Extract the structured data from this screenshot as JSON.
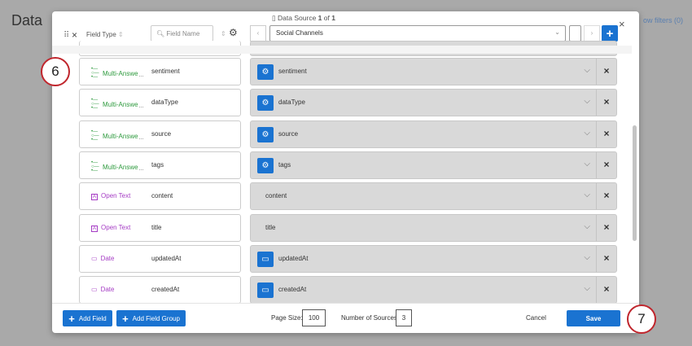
{
  "background": {
    "title": "Data",
    "filters": "ow filters (0)"
  },
  "header": {
    "field_type": "Field Type",
    "field_name_placeholder": "Field Name",
    "data_source_prefix": "Data Source",
    "data_source_current": "1",
    "data_source_of": "of",
    "data_source_total": "1",
    "source_select": "Social Channels"
  },
  "rows": [
    {
      "type": "Multi-Answe",
      "suffix": "...",
      "name": "sentiment",
      "kind": "multi",
      "mapped": "sentiment",
      "icon": "gear"
    },
    {
      "type": "Multi-Answe",
      "suffix": "...",
      "name": "dataType",
      "kind": "multi",
      "mapped": "dataType",
      "icon": "gear"
    },
    {
      "type": "Multi-Answe",
      "suffix": "...",
      "name": "source",
      "kind": "multi",
      "mapped": "source",
      "icon": "gear"
    },
    {
      "type": "Multi-Answe",
      "suffix": "...",
      "name": "tags",
      "kind": "multi",
      "mapped": "tags",
      "icon": "gear"
    },
    {
      "type": "Open Text",
      "suffix": "",
      "name": "content",
      "kind": "text",
      "mapped": "content",
      "icon": ""
    },
    {
      "type": "Open Text",
      "suffix": "",
      "name": "title",
      "kind": "text",
      "mapped": "title",
      "icon": ""
    },
    {
      "type": "Date",
      "suffix": "",
      "name": "updatedAt",
      "kind": "date",
      "mapped": "updatedAt",
      "icon": "calendar"
    },
    {
      "type": "Date",
      "suffix": "",
      "name": "createdAt",
      "kind": "date",
      "mapped": "createdAt",
      "icon": "calendar"
    }
  ],
  "footer": {
    "add_field": "Add Field",
    "add_field_group": "Add Field Group",
    "page_size_label": "Page Size:",
    "page_size": "100",
    "num_sources_label": "Number of Sources:",
    "num_sources": "3",
    "cancel": "Cancel",
    "save": "Save"
  },
  "callouts": {
    "step6": "6",
    "step7": "7"
  },
  "colors": {
    "multi": "#2e9a3e",
    "text": "#a53cc4",
    "date": "#a53cc4",
    "accent": "#1a73d1"
  }
}
